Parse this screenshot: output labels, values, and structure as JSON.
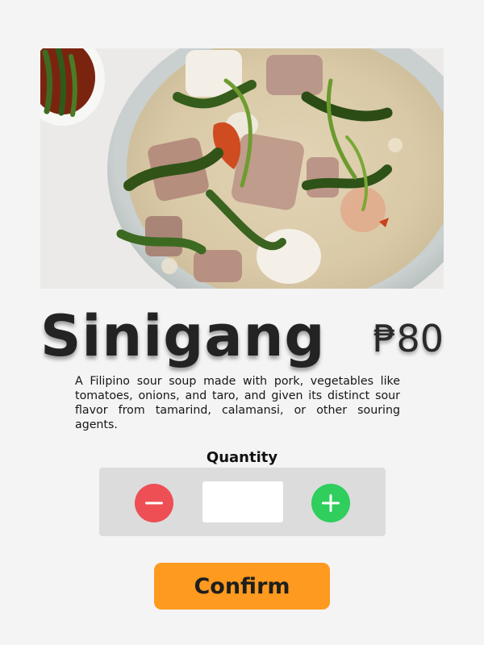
{
  "product": {
    "name": "Sinigang",
    "price": "₱80",
    "description": "A Filipino sour soup made with pork, vegetables like tomatoes, onions, and taro, and given its distinct sour flavor from tamarind, calamansi, or other souring agents.",
    "image_icon": "food-photo"
  },
  "quantity": {
    "label": "Quantity",
    "value": "",
    "decrement_icon": "minus-icon",
    "increment_icon": "plus-icon"
  },
  "actions": {
    "confirm_label": "Confirm"
  },
  "colors": {
    "background": "#f4f4f4",
    "decrement": "#ee4f55",
    "increment": "#2fce5d",
    "confirm": "#fd9a1f",
    "quantity_panel": "#dcdcdc"
  }
}
